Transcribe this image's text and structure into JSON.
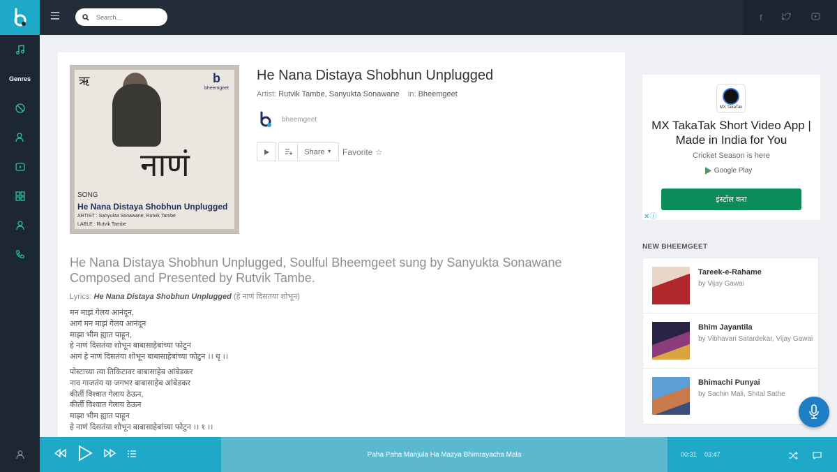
{
  "search": {
    "placeholder": "Search..."
  },
  "sidebar": {
    "genres_label": "Genres"
  },
  "song": {
    "title": "He Nana Distaya Shobhun Unplugged",
    "artist_label": "Artist:",
    "artists": "Rutvik Tambe, Sanyukta Sonawane",
    "in_label": "in:",
    "category": "Bheemgeet",
    "uploader": "bheemgeet",
    "share_label": "Share",
    "favorite_label": "Favorite"
  },
  "cover": {
    "brand": "bheemgeet",
    "song_label": "SONG",
    "title": "He Nana Distaya Shobhun Unplugged",
    "artist_line": "ARTIST : Sanyukta Sonawane, Rutvik Tambe",
    "label_line": "LABLE : Rutvik Tambe",
    "big_text": "नाणं"
  },
  "description": "He Nana Distaya Shobhun Unplugged, Soulful Bheemgeet sung by  Sanyukta Sonawane Composed and Presented by Rutvik Tambe.",
  "lyrics": {
    "label": "Lyrics:",
    "title": "He Nana Distaya Shobhun Unplugged",
    "title_marathi": "(हे नाणं दिसतया शोभून)",
    "stanzas": [
      [
        "मन माझं गेलय आनंदून,",
        "आगं मन माझं गेलय आनंदून",
        "माझा भीम ह्यात पाहून,",
        "हे नाणं दिसतंया शोभून बाबासाहेबांच्या फोटुन",
        "आगं हे नाणं दिसतंया शोभून बाबासाहेबांच्या फोटुन ।। धृ ।।"
      ],
      [
        "पोस्टाच्या त्या तिकिटावर बाबासाहेब आंबेडकर",
        "नाव गाजतंय या जगभर बाबासाहेब आंबेडकर",
        "कीर्ती विश्वात गेलाय ठेऊन,",
        "कीर्ती विश्वात गेलाय ठेऊन",
        "माझा भीम ह्यात पाहून",
        "हे नाणं दिसतंया शोभून बाबासाहेबांच्या फोटुन ।। १ ।।"
      ]
    ]
  },
  "ad": {
    "app_icon_text": "MX TakaTak",
    "headline": "MX TakaTak Short Video App | Made in India for You",
    "subline": "Cricket Season is here",
    "store": "Google Play",
    "cta": "इंस्टॉल करा"
  },
  "new_section": {
    "heading": "NEW BHEEMGEET",
    "items": [
      {
        "title": "Tareek-e-Rahame",
        "artist": "by Vijay Gawai"
      },
      {
        "title": "Bhim Jayantila",
        "artist": "by Vibhavari Satardekar, Vijay Gawai"
      },
      {
        "title": "Bhimachi Punyai",
        "artist": "by Sachin Mali, Shital Sathe"
      }
    ]
  },
  "player": {
    "now_playing": "Paha Paha Manjula Ha Mazya Bhimrayacha Mala",
    "elapsed": "00:31",
    "duration": "03:47"
  },
  "colors": {
    "accent": "#1fa9c9",
    "sidebar": "#1d2733",
    "topbar": "#222d39",
    "icon_green": "#2ec3a4",
    "cta_green": "#0b8a5a"
  }
}
